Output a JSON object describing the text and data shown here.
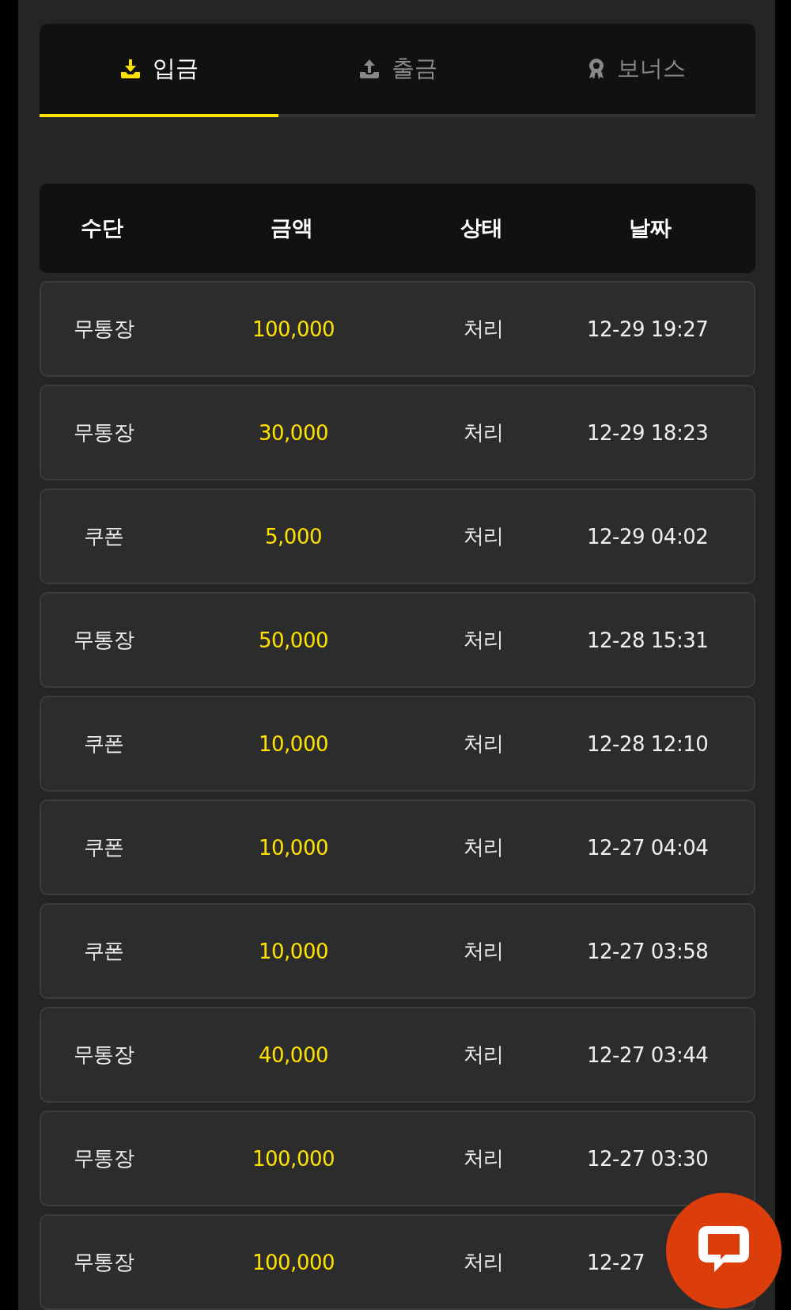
{
  "tabs": [
    {
      "label": "입금",
      "selected": true
    },
    {
      "label": "출금",
      "selected": false
    },
    {
      "label": "보너스",
      "selected": false
    }
  ],
  "table": {
    "columns": [
      "수단",
      "금액",
      "상태",
      "날짜"
    ],
    "rows": [
      {
        "method": "무통장",
        "amount": "100,000",
        "status": "처리",
        "date": "12-29 19:27"
      },
      {
        "method": "무통장",
        "amount": "30,000",
        "status": "처리",
        "date": "12-29 18:23"
      },
      {
        "method": "쿠폰",
        "amount": "5,000",
        "status": "처리",
        "date": "12-29 04:02"
      },
      {
        "method": "무통장",
        "amount": "50,000",
        "status": "처리",
        "date": "12-28 15:31"
      },
      {
        "method": "쿠폰",
        "amount": "10,000",
        "status": "처리",
        "date": "12-28 12:10"
      },
      {
        "method": "쿠폰",
        "amount": "10,000",
        "status": "처리",
        "date": "12-27 04:04"
      },
      {
        "method": "쿠폰",
        "amount": "10,000",
        "status": "처리",
        "date": "12-27 03:58"
      },
      {
        "method": "무통장",
        "amount": "40,000",
        "status": "처리",
        "date": "12-27 03:44"
      },
      {
        "method": "무통장",
        "amount": "100,000",
        "status": "처리",
        "date": "12-27 03:30"
      },
      {
        "method": "무통장",
        "amount": "100,000",
        "status": "처리",
        "date": "12-27"
      }
    ]
  }
}
